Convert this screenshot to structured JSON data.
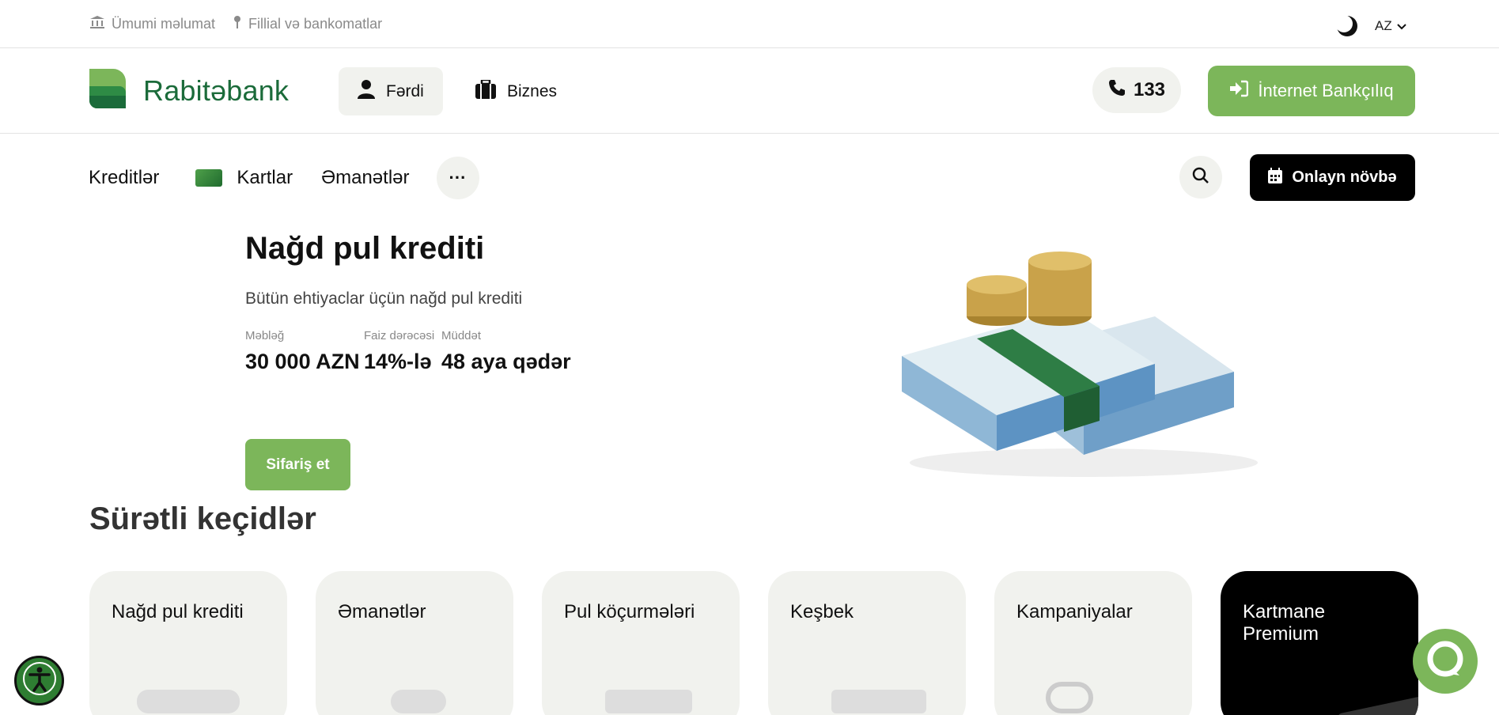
{
  "topbar": {
    "links": [
      {
        "label": "Ümumi məlumat",
        "icon": "bank-icon"
      },
      {
        "label": "Fillial və bankomatlar",
        "icon": "location-pin-icon"
      }
    ],
    "language": "AZ"
  },
  "header": {
    "logo_text": "Rabitəbank",
    "segments": [
      {
        "label": "Fərdi",
        "icon": "user-icon",
        "active": true
      },
      {
        "label": "Biznes",
        "icon": "briefcase-icon",
        "active": false
      }
    ],
    "phone": "133",
    "internet_banking_label": "İnternet Bankçılıq"
  },
  "nav": {
    "items": [
      "Kreditlər",
      "Kartlar",
      "Əmanətlər"
    ],
    "more_label": "···",
    "queue_label": "Onlayn növbə"
  },
  "hero": {
    "title": "Nağd pul krediti",
    "subtitle": "Bütün ehtiyaclar üçün nağd pul krediti",
    "stats": [
      {
        "label": "Məbləğ",
        "value": "30 000 AZN"
      },
      {
        "label": "Faiz dərəcəsi",
        "value": "14%-lə"
      },
      {
        "label": "Müddət",
        "value": "48 aya qədər"
      }
    ],
    "order_label": "Sifariş et"
  },
  "quick_links": {
    "title": "Sürətli keçidlər",
    "cards": [
      {
        "label": "Nağd pul krediti"
      },
      {
        "label": "Əmanətlər"
      },
      {
        "label": "Pul köçurmələri"
      },
      {
        "label": "Keşbek"
      },
      {
        "label": "Kampaniyalar"
      },
      {
        "label": "Kartmane Premium"
      }
    ]
  },
  "colors": {
    "brand_green": "#7cb65a",
    "logo_green": "#1b6b3a",
    "light_bg": "#f1f2ee",
    "dark": "#000000"
  }
}
